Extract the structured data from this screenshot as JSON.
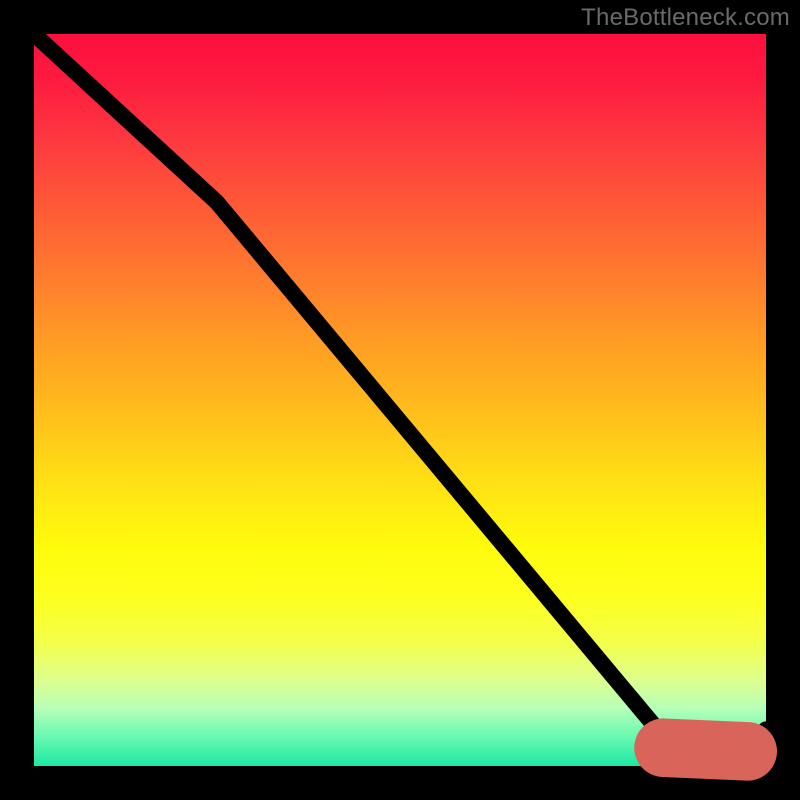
{
  "watermark": "TheBottleneck.com",
  "colors": {
    "background": "#000000",
    "line": "#000000",
    "dash": "#d9655a"
  },
  "chart_data": {
    "type": "line",
    "title": "",
    "xlabel": "",
    "ylabel": "",
    "xlim": [
      0,
      100
    ],
    "ylim": [
      0,
      100
    ],
    "series": [
      {
        "name": "bottleneck-curve",
        "x": [
          0,
          25,
          86,
          88,
          95,
          100
        ],
        "y": [
          100,
          77,
          4,
          1,
          1,
          5
        ]
      },
      {
        "name": "dashed-flat-segment",
        "x": [
          86,
          97.5
        ],
        "y": [
          2.5,
          2
        ]
      }
    ],
    "points": [
      {
        "name": "dashed-end-dot",
        "x": 97.5,
        "y": 2
      }
    ],
    "notes": "Chart has no visible axes, ticks, or numeric labels; values above are estimated from curve geometry on a 0–100 normalized scale in both directions."
  }
}
